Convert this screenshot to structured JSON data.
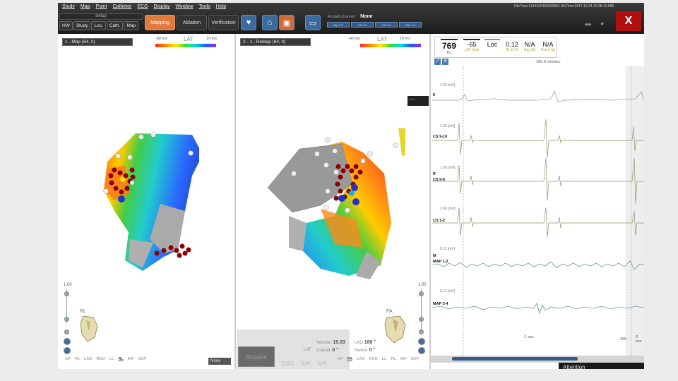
{
  "menu": [
    "Study",
    "Map",
    "Point",
    "Catheter",
    "ECG",
    "Display",
    "Window",
    "Tools",
    "Help"
  ],
  "toolbar": {
    "setup_label": "Setup",
    "subtabs": [
      "HW",
      "Study",
      "Loc.",
      "Cath.",
      "Map"
    ],
    "modes": [
      "Mapping",
      "Ablation",
      "Verification"
    ],
    "routed_label": "Routed channel",
    "routed_value": "None",
    "routed_buttons": [
      "Wp 1-2",
      "CS 1-2",
      "CS 3-4",
      "Wm 1-2"
    ],
    "filetime": "FileTime:1315332169250551 39;Time:2017.10.24.12:28:12.585",
    "logo_text": "X"
  },
  "left_map": {
    "header": "1 - Map (64, 0)",
    "lat_min": "-80 ms",
    "lat_title": "LAT",
    "lat_max": "19 ms",
    "scale_value": "1.00",
    "orientation": "RL",
    "display_select": "None"
  },
  "right_map": {
    "header": "2 - 1 - ReMap (84, 0)",
    "lat_min": "-43 ms",
    "lat_title": "LAT",
    "lat_max": "19 ms",
    "scale_value": "1.00",
    "orientation": "PA",
    "volume_label": "Volume:",
    "volume_value": "19.83",
    "lao_label": "LAO",
    "lao_value": "180 °",
    "cranial_label": "Cranial:",
    "cranial_value": "0 °",
    "swivel_label": "Swivel:",
    "swivel_value": "0 °",
    "acquire_label": "Acquire",
    "na_values": [
      "2083",
      "N/A",
      "N/A"
    ],
    "lat_text": "LAT"
  },
  "view_buttons": [
    "AP",
    "PA",
    "LAO",
    "RAO",
    "LL",
    "RL",
    "INF",
    "SUP"
  ],
  "readout": {
    "cl_value": "769",
    "cl_label": "CL",
    "lat_value": "-65",
    "lat_label": "LAT (ms)",
    "loc_value": "Loc",
    "bi_value": "0.12",
    "bi_label": "Bi (mV)",
    "imp_value": "N/A",
    "imp_label": "Imp (Ω)",
    "force_value": "N/A",
    "force_label": "Force (g)"
  },
  "ecg": {
    "speed": "100.0 mm/sec",
    "channels": [
      {
        "label": "II",
        "scale": "1.00 [mV]"
      },
      {
        "label": "CS 9-10",
        "scale": "1.00 [mV]"
      },
      {
        "label": "CS 5-6",
        "scale": "1.00 [mV]"
      },
      {
        "label": "CS 1-2",
        "scale": "1.00 [mV]"
      },
      {
        "label": "MAP 1-2",
        "scale": "0.11 [mV]"
      },
      {
        "label": "MAP 3-4",
        "scale": "0.12 [mV]"
      }
    ],
    "r_marker": "R",
    "m_marker": "M",
    "time_minus1": "-1 sec",
    "time_minus100": "-100",
    "time_zero": "0 sec"
  },
  "attention": "Attention",
  "colors": {
    "mapping_active": "#e07a3c",
    "ecg_trace": "#8a9a7a",
    "map_trace": "#3a7a8a"
  }
}
